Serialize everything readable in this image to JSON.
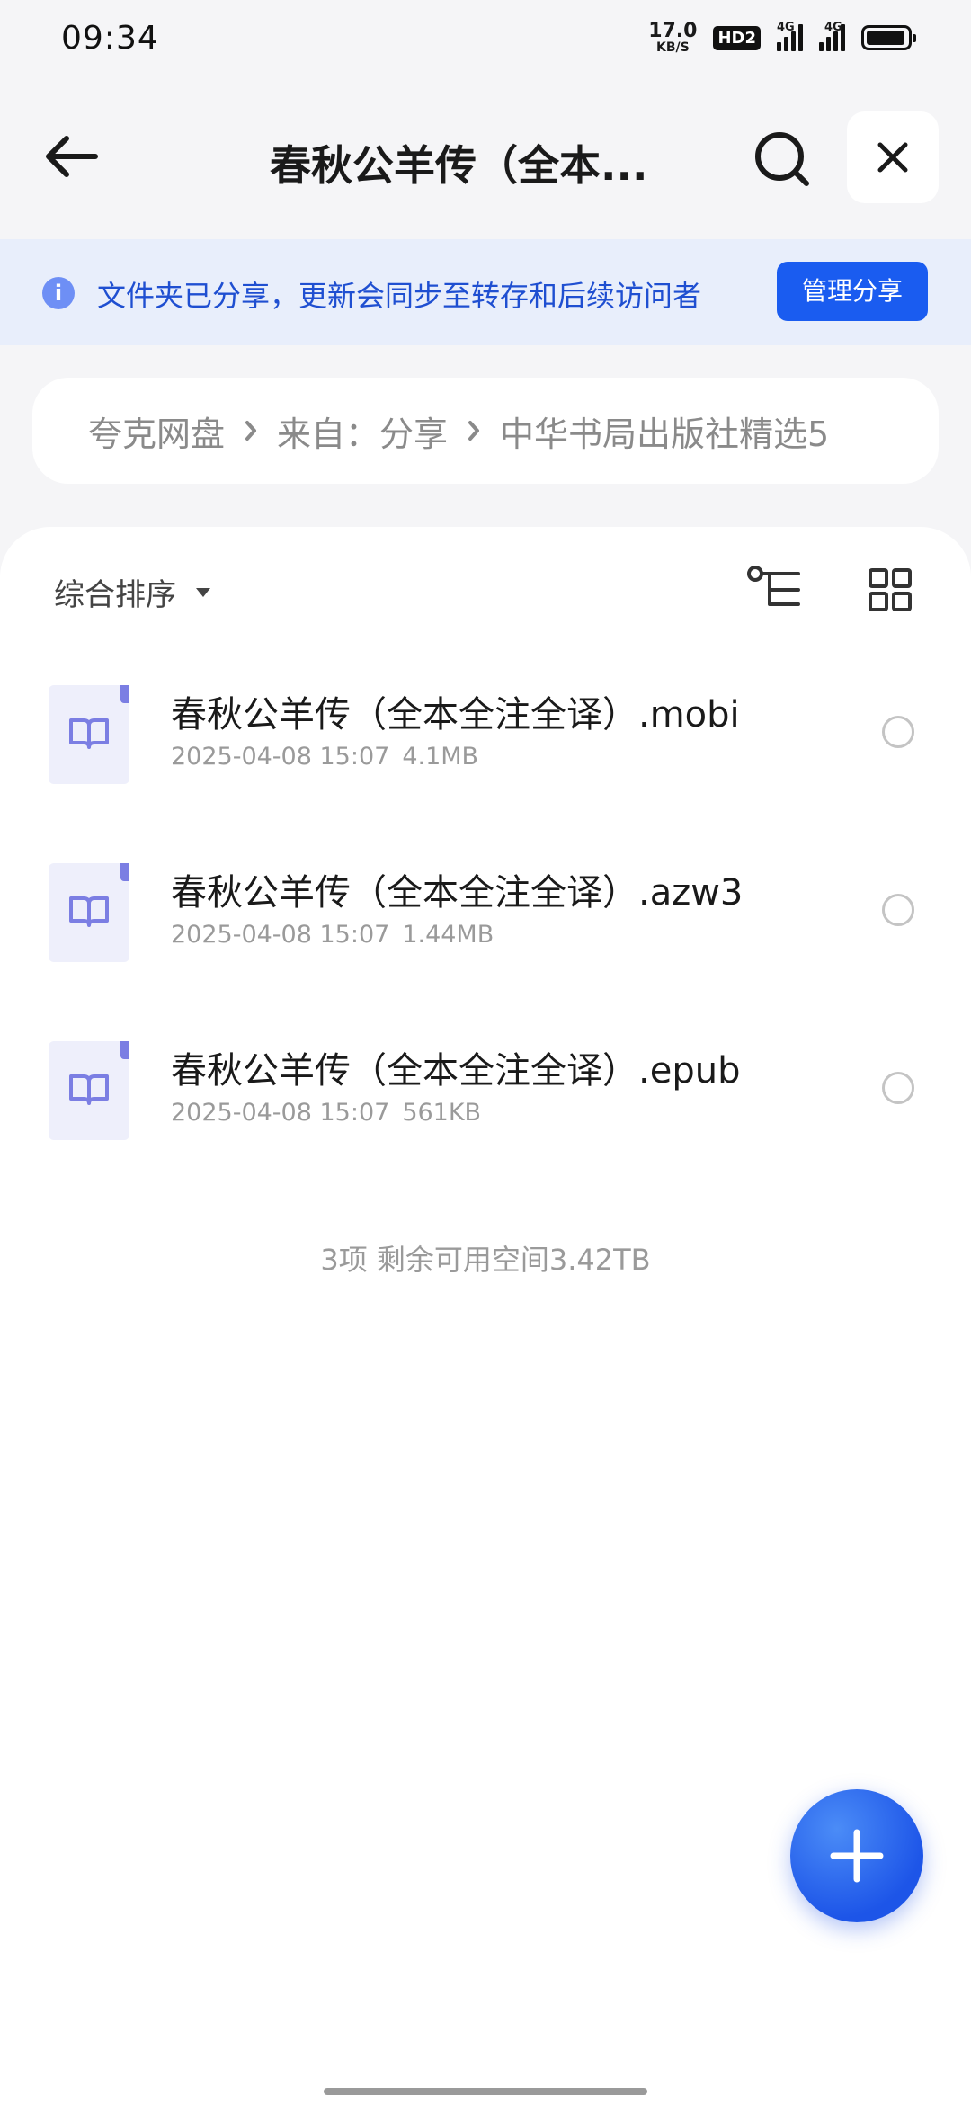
{
  "status_bar": {
    "time": "09:34",
    "net_speed_value": "17.0",
    "net_speed_unit": "KB/S",
    "hd_badge": "HD2",
    "signal1_tag": "4G",
    "signal2_tag": "4G",
    "battery_level": 0.95
  },
  "header": {
    "title": "春秋公羊传（全本...",
    "back_icon": "arrow-left-icon",
    "search_icon": "search-icon",
    "close_icon": "close-icon"
  },
  "notice": {
    "text": "文件夹已分享，更新会同步至转存和后续访问者",
    "button_label": "管理分享",
    "info_icon": "info-icon",
    "accent_color": "#1a5cf0"
  },
  "breadcrumb": {
    "items": [
      "夸克网盘",
      "来自：分享",
      "中华书局出版社精选5"
    ]
  },
  "toolbar": {
    "sort_label": "综合排序",
    "tree_icon": "tree-view-icon",
    "grid_icon": "grid-view-icon"
  },
  "files": [
    {
      "name": "春秋公羊传（全本全注全译）.mobi",
      "date": "2025-04-08 15:07",
      "size": "4.1MB"
    },
    {
      "name": "春秋公羊传（全本全注全译）.azw3",
      "date": "2025-04-08 15:07",
      "size": "1.44MB"
    },
    {
      "name": "春秋公羊传（全本全注全译）.epub",
      "date": "2025-04-08 15:07",
      "size": "561KB"
    }
  ],
  "summary": "3项 剩余可用空间3.42TB",
  "fab": {
    "icon": "plus-icon"
  }
}
